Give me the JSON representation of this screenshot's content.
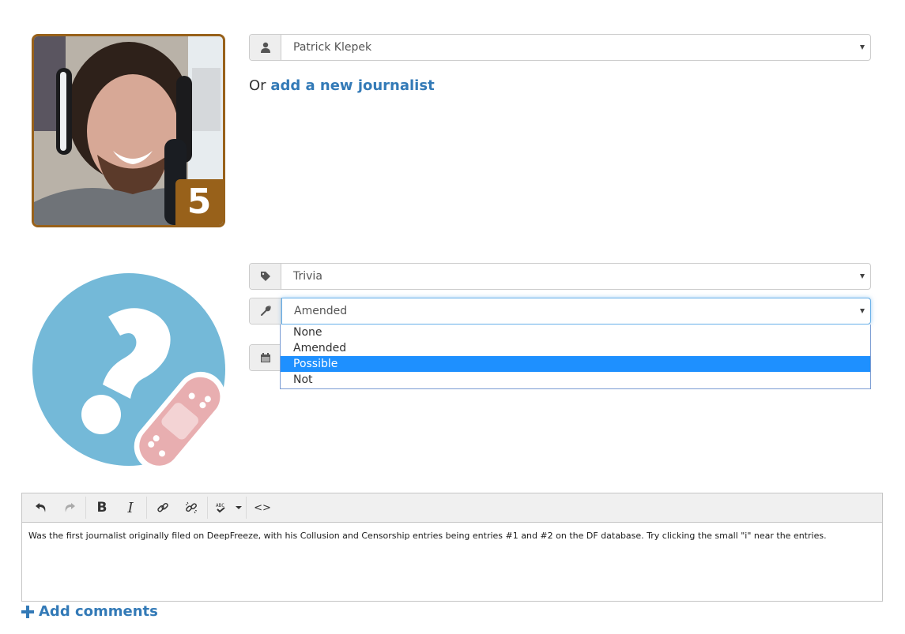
{
  "journalist": {
    "name": "Patrick Klepek",
    "rank": "5",
    "avatar_alt": "journalist-photo",
    "or_prefix": "Or",
    "add_new_link": "add a new journalist"
  },
  "entry": {
    "category_value": "Trivia",
    "status_value": "Amended",
    "status_options": [
      "None",
      "Amended",
      "Possible",
      "Not"
    ],
    "status_highlighted": "Possible",
    "date_value": "",
    "status_image": "question-bandage-icon"
  },
  "editor": {
    "toolbar": {
      "undo": "undo-icon",
      "redo": "redo-icon",
      "bold": "B",
      "italic": "I",
      "link": "link-icon",
      "unlink": "unlink-icon",
      "spellcheck": "spellcheck-icon",
      "code": "<>"
    },
    "content": "Was the first journalist originally filed on DeepFreeze, with his Collusion and Censorship entries being entries #1 and #2 on the DF database. Try clicking the small \"i\" near the entries."
  },
  "add_comments_label": "Add comments",
  "colors": {
    "rank_badge": "#98611a",
    "link": "#337ab7",
    "highlight": "#1e90ff",
    "status_circle": "#74b9d8",
    "bandage": "#e8aeb0"
  }
}
